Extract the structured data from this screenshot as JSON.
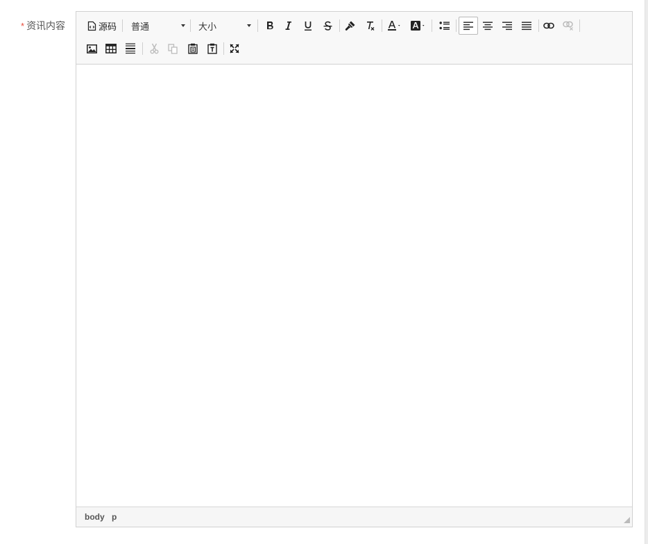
{
  "field": {
    "required_mark": "*",
    "label": "资讯内容"
  },
  "toolbar": {
    "source_label": "源码",
    "format_value": "普通",
    "size_value": "大小"
  },
  "statusbar": {
    "path": [
      "body",
      "p"
    ]
  }
}
